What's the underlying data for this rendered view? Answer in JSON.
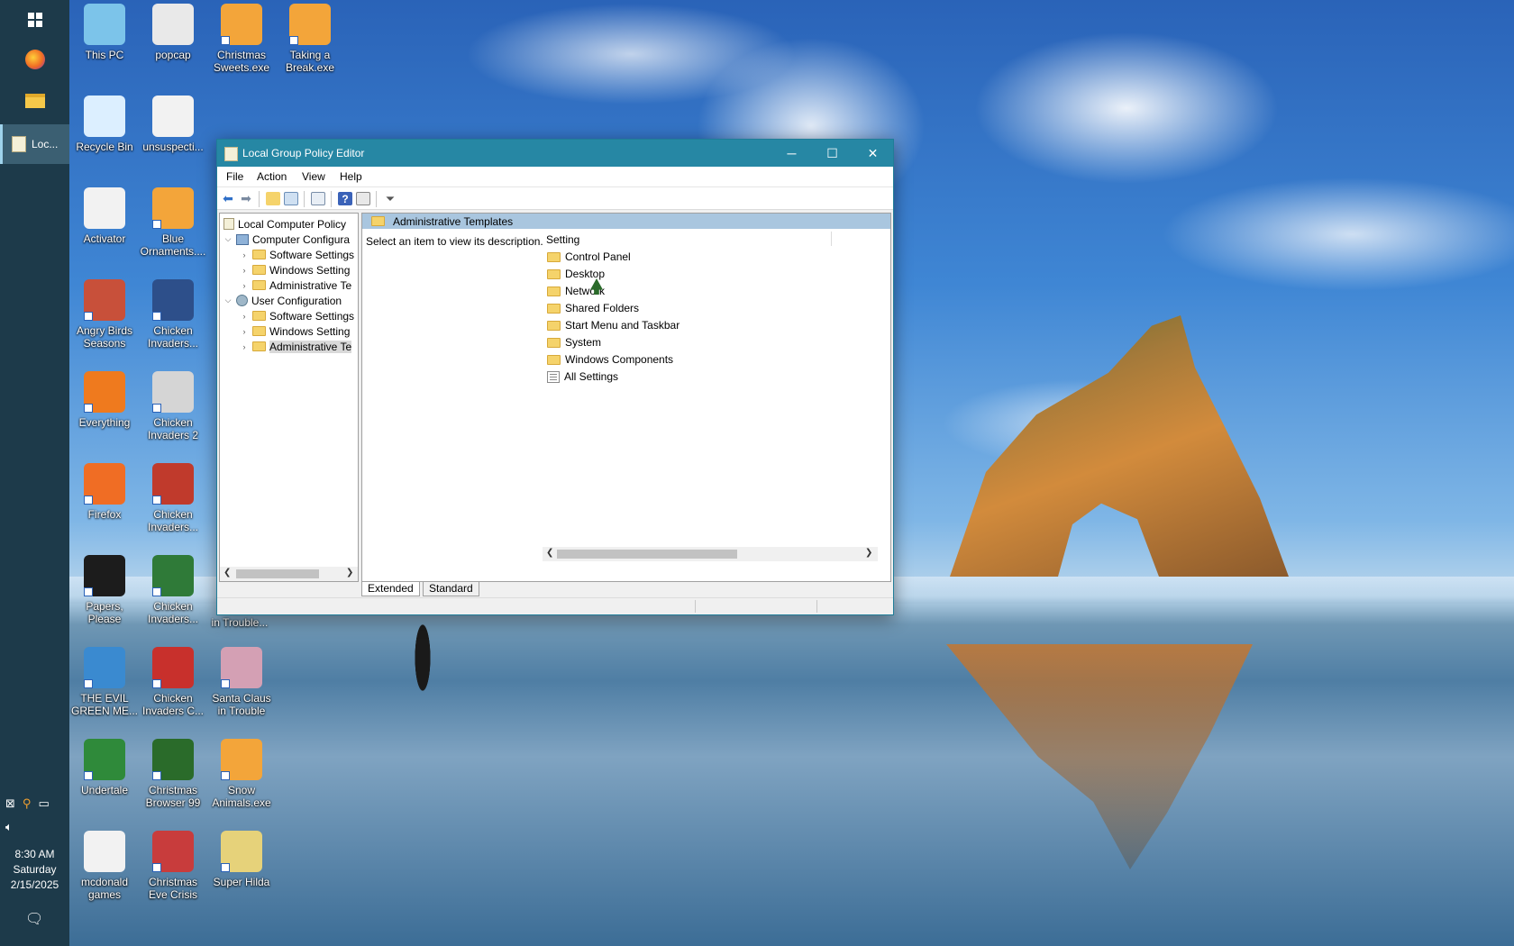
{
  "taskbar": {
    "active_app_label": "Loc...",
    "clock_time": "8:30 AM",
    "clock_day": "Saturday",
    "clock_date": "2/15/2025"
  },
  "desktop_icons": [
    {
      "label": "This PC",
      "icon": "this-pc-icon",
      "color": "#7cc4ea"
    },
    {
      "label": "popcap",
      "icon": "folder-icon",
      "color": "#e9e9e9"
    },
    {
      "label": "Christmas Sweets.exe",
      "icon": "popcap-flower-icon",
      "color": "#f3a53a"
    },
    {
      "label": "Taking a Break.exe",
      "icon": "popcap-flower-icon",
      "color": "#f3a53a"
    },
    {
      "label": "Recycle Bin",
      "icon": "recycle-bin-icon",
      "color": "#dcefff"
    },
    {
      "label": "unsuspecti...",
      "icon": "file-icon",
      "color": "#f2f2f2"
    },
    {
      "label": "Activator",
      "icon": "file-icon",
      "color": "#f2f2f2"
    },
    {
      "label": "Blue Ornaments....",
      "icon": "popcap-flower-icon",
      "color": "#f3a53a"
    },
    {
      "label": "Angry Birds Seasons",
      "icon": "angry-birds-icon",
      "color": "#c8503a"
    },
    {
      "label": "Chicken Invaders...",
      "icon": "chicken-invaders-icon",
      "color": "#2d4f8a"
    },
    {
      "label": "Everything",
      "icon": "everything-search-icon",
      "color": "#ef7a1e"
    },
    {
      "label": "Chicken Invaders 2",
      "icon": "chicken-invaders-icon",
      "color": "#d5d5d5"
    },
    {
      "label": "Firefox",
      "icon": "firefox-icon",
      "color": "#f06d24"
    },
    {
      "label": "Chicken Invaders...",
      "icon": "chicken-invaders-icon",
      "color": "#c03a2c"
    },
    {
      "label": "Papers, Please",
      "icon": "papers-please-icon",
      "color": "#1c1c1c"
    },
    {
      "label": "Chicken Invaders...",
      "icon": "chicken-invaders-icon",
      "color": "#2f7a38"
    },
    {
      "label": "THE EVIL GREEN ME...",
      "icon": "messenger-people-icon",
      "color": "#3a8ad0"
    },
    {
      "label": "Chicken Invaders C...",
      "icon": "chicken-invaders-icon",
      "color": "#c8302c"
    },
    {
      "label": "Santa Claus in Trouble",
      "icon": "santa-icon",
      "color": "#d4a0b4"
    },
    {
      "label": "Undertale",
      "icon": "undertale-icon",
      "color": "#2f8a3a"
    },
    {
      "label": "Christmas Browser 99",
      "icon": "christmas-tree-icon",
      "color": "#2a6b2a"
    },
    {
      "label": "Snow Animals.exe",
      "icon": "popcap-flower-icon",
      "color": "#f3a53a"
    },
    {
      "label": "mcdonald games",
      "icon": "file-icon",
      "color": "#f2f2f2"
    },
    {
      "label": "Christmas Eve Crisis",
      "icon": "santa-icon",
      "color": "#c83c3c"
    },
    {
      "label": "Super Hilda",
      "icon": "pixel-dog-icon",
      "color": "#e6d27a"
    },
    {
      "label": "in Trouble...",
      "icon": "",
      "color": ""
    }
  ],
  "window": {
    "title": "Local Group Policy Editor",
    "minimize": "─",
    "maximize": "☐",
    "close": "✕",
    "menu": [
      "File",
      "Action",
      "View",
      "Help"
    ],
    "tree": [
      {
        "label": "Local Computer Policy"
      },
      {
        "label": "Computer Configura"
      },
      {
        "label": "Software Settings"
      },
      {
        "label": "Windows Setting"
      },
      {
        "label": "Administrative Te"
      },
      {
        "label": "User Configuration"
      },
      {
        "label": "Software Settings"
      },
      {
        "label": "Windows Setting"
      },
      {
        "label": "Administrative Te"
      }
    ],
    "right_header": "Administrative Templates",
    "description": "Select an item to view its description.",
    "column_header": "Setting",
    "items": [
      "Control Panel",
      "Desktop",
      "Network",
      "Shared Folders",
      "Start Menu and Taskbar",
      "System",
      "Windows Components",
      "All Settings"
    ],
    "tabs": [
      "Extended",
      "Standard"
    ]
  }
}
